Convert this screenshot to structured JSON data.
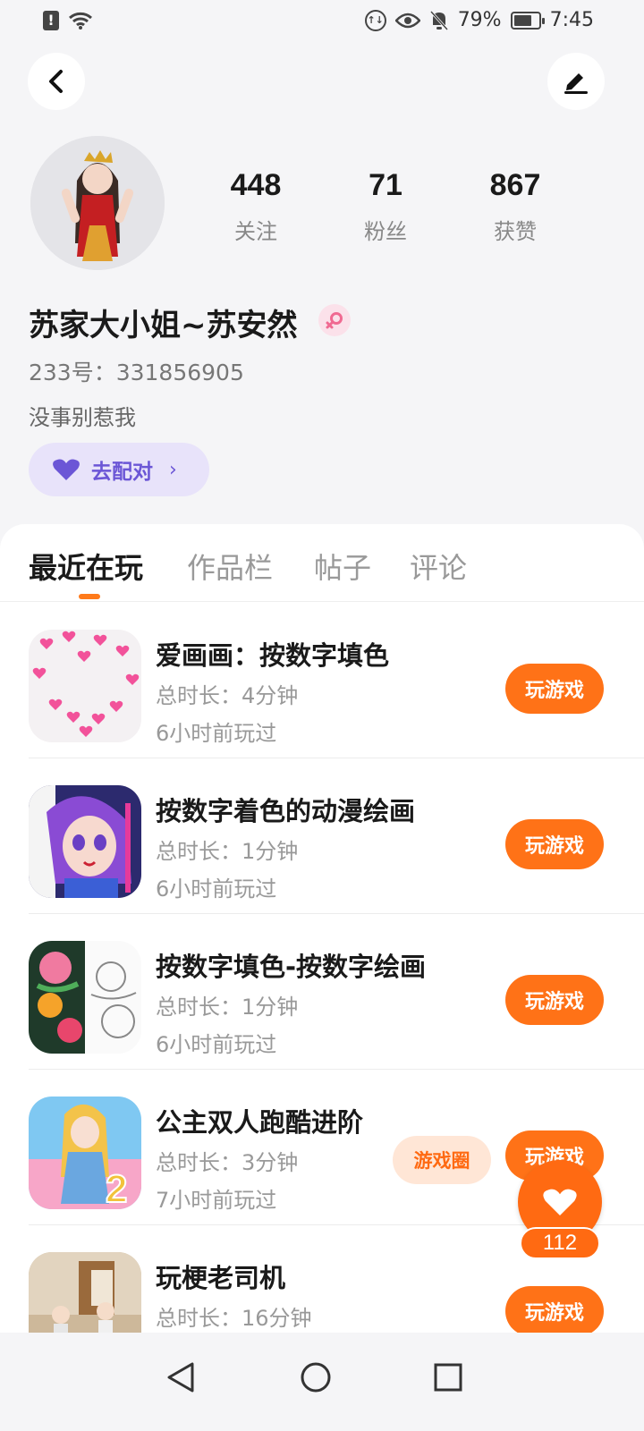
{
  "status_bar": {
    "battery": "79%",
    "time": "7:45",
    "battery_level": 0.79,
    "icons": [
      "alert-icon",
      "wifi-icon",
      "data-saver-icon",
      "eye-icon",
      "mute-bell-icon",
      "battery-icon"
    ]
  },
  "header": {
    "back_icon": "chevron-left-icon",
    "edit_icon": "pen-icon"
  },
  "profile": {
    "stats": [
      {
        "num": "448",
        "label": "关注"
      },
      {
        "num": "71",
        "label": "粉丝"
      },
      {
        "num": "867",
        "label": "获赞"
      }
    ],
    "username": "苏家大小姐~苏安然",
    "gender_icon": "female-icon",
    "uid": "233号：331856905",
    "bio": "没事别惹我",
    "match_label": "去配对",
    "match_icon": "heart-icon"
  },
  "tabs": [
    {
      "label": "最近在玩",
      "active": true
    },
    {
      "label": "作品栏",
      "active": false
    },
    {
      "label": "帖子",
      "active": false
    },
    {
      "label": "评论",
      "active": false
    }
  ],
  "games": [
    {
      "title": "爱画画：按数字填色",
      "duration": "总时长：4分钟",
      "last_played": "6小时前玩过",
      "play_label": "玩游戏",
      "icon": "hearts-love-icon"
    },
    {
      "title": "按数字着色的动漫绘画",
      "duration": "总时长：1分钟",
      "last_played": "6小时前玩过",
      "play_label": "玩游戏",
      "icon": "anime-girl-icon"
    },
    {
      "title": "按数字填色-按数字绘画",
      "duration": "总时长：1分钟",
      "last_played": "6小时前玩过",
      "play_label": "玩游戏",
      "icon": "flower-coloring-icon"
    },
    {
      "title": "公主双人跑酷进阶",
      "duration": "总时长：3分钟",
      "last_played": "7小时前玩过",
      "play_label": "玩游戏",
      "circle_label": "游戏圈",
      "icon": "princess-runner-icon"
    },
    {
      "title": "玩梗老司机",
      "duration": "总时长：16分钟",
      "last_played": "",
      "play_label": "玩游戏",
      "icon": "cartoon-room-icon"
    }
  ],
  "float_like": {
    "count": "112"
  },
  "nav": [
    "back-triangle-icon",
    "home-circle-icon",
    "recents-square-icon"
  ],
  "colors": {
    "accent": "#ff7217",
    "purple": "#6b56d6",
    "background": "#f5f5f7"
  }
}
